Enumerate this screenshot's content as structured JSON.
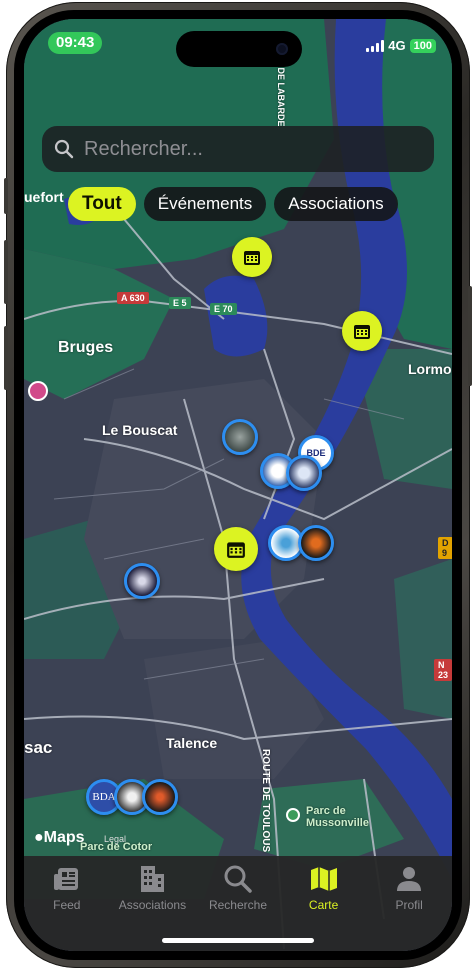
{
  "status_bar": {
    "time": "09:43",
    "network": "4G",
    "battery": "100"
  },
  "search": {
    "placeholder": "Rechercher..."
  },
  "filters": {
    "partial_label": "uefort",
    "chips": [
      {
        "label": "Tout",
        "active": true
      },
      {
        "label": "Événements",
        "active": false
      },
      {
        "label": "Associations",
        "active": false
      }
    ]
  },
  "map": {
    "labels": {
      "bruges": "Bruges",
      "le_bouscat": "Le Bouscat",
      "talence": "Talence",
      "lormont": "Lormor",
      "sac": "sac",
      "route_toulouse": "ROUTE DE TOULOUS",
      "labarde": "E DE LABARDE",
      "parc_mussonville": "Parc de Mussonville",
      "parc_cotor": "Parc de Cotor"
    },
    "roads": {
      "a630": "A 630",
      "e5": "E 5",
      "e70": "E 70",
      "d9": "D 9",
      "n23": "N 23"
    },
    "association_pin_texts": {
      "bde": "BDE",
      "bda": "BDA"
    },
    "attribution": {
      "logo": "Maps",
      "legal": "Legal"
    }
  },
  "tabs": [
    {
      "label": "Feed",
      "icon": "feed-icon"
    },
    {
      "label": "Associations",
      "icon": "building-icon"
    },
    {
      "label": "Recherche",
      "icon": "search-icon"
    },
    {
      "label": "Carte",
      "icon": "map-icon"
    },
    {
      "label": "Profil",
      "icon": "person-icon"
    }
  ],
  "colors": {
    "accent": "#dcf322",
    "status_green": "#33c75a",
    "pin_border": "#2d8ef0",
    "river": "#2a3d9e"
  }
}
